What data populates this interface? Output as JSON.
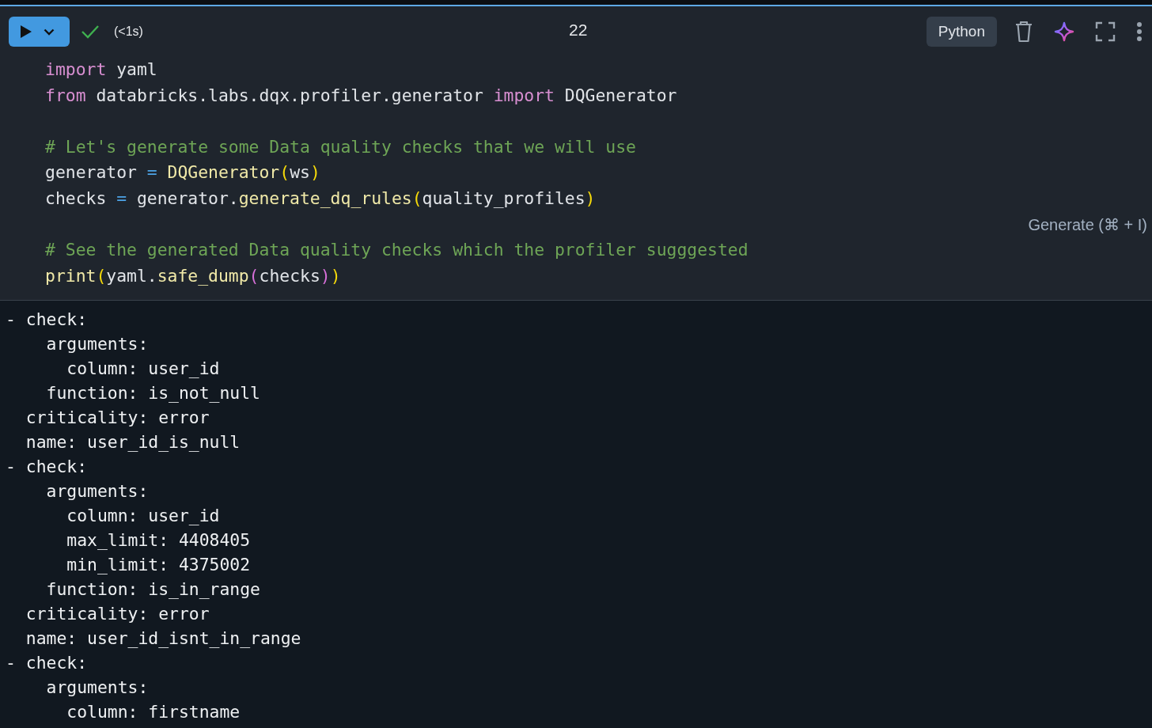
{
  "cell": {
    "status": {
      "succeeded": true,
      "duration": "(<1s)"
    },
    "cell_number": "22",
    "language": "Python",
    "code": [
      {
        "kind": "code",
        "tokens": [
          {
            "kind": "keyword",
            "text": "import"
          },
          {
            "kind": "plain",
            "text": " yaml"
          }
        ]
      },
      {
        "kind": "code",
        "tokens": [
          {
            "kind": "keyword",
            "text": "from"
          },
          {
            "kind": "plain",
            "text": " databricks.labs.dqx.profiler.generator "
          },
          {
            "kind": "keyword",
            "text": "import"
          },
          {
            "kind": "plain",
            "text": " DQGenerator"
          }
        ]
      },
      {
        "kind": "blank"
      },
      {
        "kind": "code",
        "tokens": [
          {
            "kind": "comment",
            "text": "# Let's generate some Data quality checks that we will use"
          }
        ]
      },
      {
        "kind": "code",
        "tokens": [
          {
            "kind": "plain",
            "text": "generator "
          },
          {
            "kind": "operator",
            "text": "="
          },
          {
            "kind": "function",
            "text": " DQGenerator"
          },
          {
            "kind": "paren",
            "text": "("
          },
          {
            "kind": "plain",
            "text": "ws"
          },
          {
            "kind": "paren",
            "text": ")"
          }
        ]
      },
      {
        "kind": "code",
        "tokens": [
          {
            "kind": "plain",
            "text": "checks "
          },
          {
            "kind": "operator",
            "text": "="
          },
          {
            "kind": "plain",
            "text": " generator."
          },
          {
            "kind": "function",
            "text": "generate_dq_rules"
          },
          {
            "kind": "paren",
            "text": "("
          },
          {
            "kind": "plain",
            "text": "quality_profiles"
          },
          {
            "kind": "paren",
            "text": ")"
          }
        ]
      },
      {
        "kind": "blank",
        "hint": "Generate (⌘ + I)"
      },
      {
        "kind": "code",
        "tokens": [
          {
            "kind": "comment",
            "text": "# See the generated Data quality checks which the profiler sugggested"
          }
        ]
      },
      {
        "kind": "code",
        "tokens": [
          {
            "kind": "function",
            "text": "print"
          },
          {
            "kind": "paren",
            "text": "("
          },
          {
            "kind": "plain",
            "text": "yaml."
          },
          {
            "kind": "function",
            "text": "safe_dump"
          },
          {
            "kind": "paren2",
            "text": "("
          },
          {
            "kind": "plain",
            "text": "checks"
          },
          {
            "kind": "paren2",
            "text": ")"
          },
          {
            "kind": "paren",
            "text": ")"
          }
        ]
      }
    ],
    "output": [
      "- check:",
      "    arguments:",
      "      column: user_id",
      "    function: is_not_null",
      "  criticality: error",
      "  name: user_id_is_null",
      "- check:",
      "    arguments:",
      "      column: user_id",
      "      max_limit: 4408405",
      "      min_limit: 4375002",
      "    function: is_in_range",
      "  criticality: error",
      "  name: user_id_isnt_in_range",
      "- check:",
      "    arguments:",
      "      column: firstname"
    ]
  }
}
